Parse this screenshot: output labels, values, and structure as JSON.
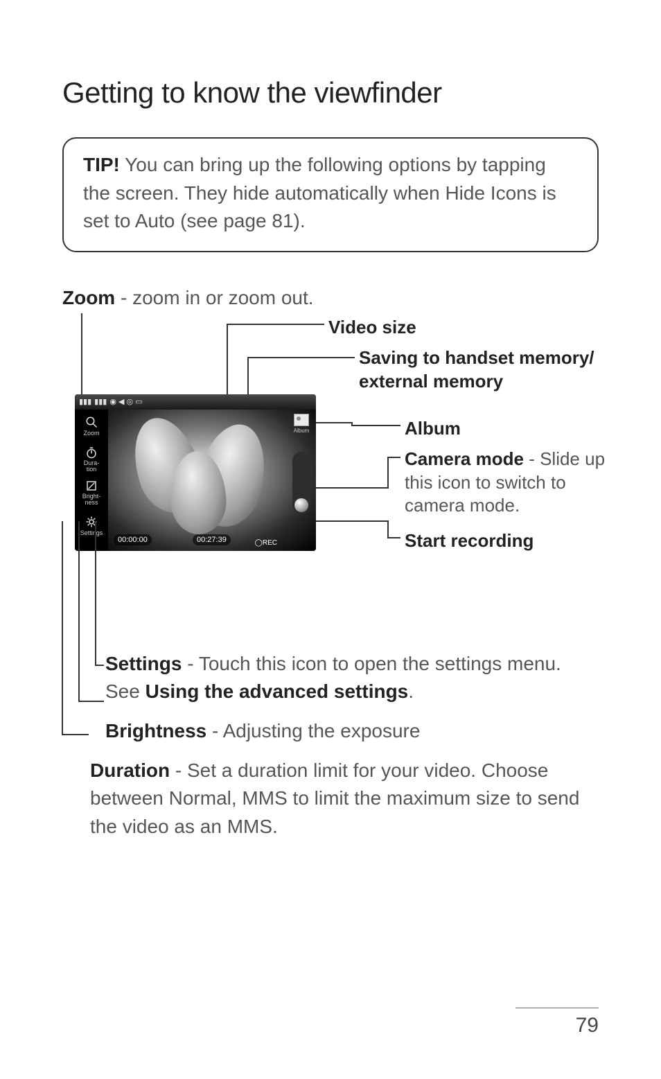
{
  "title": "Getting to know the viewfinder",
  "tip": {
    "label": "TIP!",
    "text": " You can bring up the following options by tapping the screen. They hide automatically when Hide Icons is set to Auto (see page 81)."
  },
  "zoom": {
    "label": "Zoom",
    "desc": " - zoom in or zoom out."
  },
  "screenshot": {
    "left_items": [
      {
        "icon": "zoom",
        "label": "Zoom"
      },
      {
        "icon": "duration",
        "label": "Dura-\ntion"
      },
      {
        "icon": "brightness",
        "label": "Bright-\nness"
      },
      {
        "icon": "settings",
        "label": "Settings"
      }
    ],
    "rec_elapsed": "00:00:00",
    "rec_total": "00:27:39",
    "rec_btn": "REC",
    "album_label": "Album"
  },
  "labels": {
    "video_size": "Video size",
    "saving": "Saving to handset memory/ external memory",
    "album": "Album",
    "camera_mode_b": "Camera mode",
    "camera_mode_rest": " - Slide up this icon to switch to camera mode.",
    "start_recording": "Start recording"
  },
  "below": {
    "settings_b": "Settings",
    "settings_rest_1": " - Touch this icon to open the settings menu. See ",
    "settings_rest_b": "Using the advanced settings",
    "settings_rest_2": ".",
    "brightness_b": "Brightness",
    "brightness_rest": " - Adjusting the exposure",
    "duration_b": "Duration",
    "duration_rest": " - Set a duration limit for your video. Choose between Normal, MMS to limit the maximum size to send the video as an MMS."
  },
  "page_number": "79"
}
